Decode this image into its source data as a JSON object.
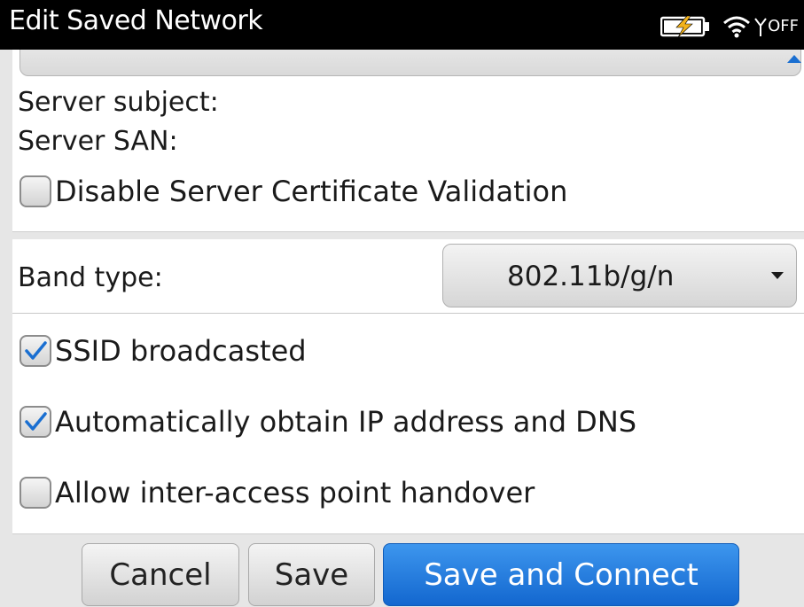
{
  "titlebar": {
    "title": "Edit Saved Network",
    "radio_state": "OFF",
    "icons": [
      "battery-charging-icon",
      "wifi-icon",
      "radio-antenna-icon"
    ]
  },
  "server": {
    "subject_label": "Server subject:",
    "san_label": "Server SAN:"
  },
  "options_top": {
    "disable_cert_validation": {
      "label": "Disable Server Certificate Validation",
      "checked": false
    }
  },
  "band": {
    "label": "Band type:",
    "value": "802.11b/g/n"
  },
  "options_bottom": {
    "ssid_broadcasted": {
      "label": "SSID broadcasted",
      "checked": true
    },
    "auto_ip_dns": {
      "label": "Automatically obtain IP address and DNS",
      "checked": true
    },
    "inter_ap_handover": {
      "label": "Allow inter-access point handover",
      "checked": false
    }
  },
  "buttons": {
    "cancel": "Cancel",
    "save": "Save",
    "save_connect": "Save and Connect"
  },
  "colors": {
    "accent": "#1a6fd1",
    "primary_button": "#1367cf",
    "titlebar": "#000000",
    "background": "#e6e6e6"
  }
}
